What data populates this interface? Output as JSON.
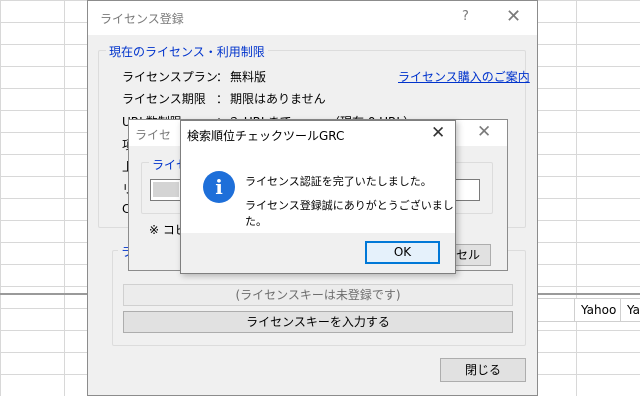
{
  "background": {
    "cells": [
      "Yahoo",
      "Ya"
    ]
  },
  "main_window": {
    "title": "ライセンス登録",
    "help_glyph": "?",
    "close_glyph": "✕",
    "current_group": {
      "legend": "現在のライセンス・利用制限",
      "plan_label": "ライセンスプラン",
      "plan_colon": "：",
      "plan_value": "無料版",
      "period_label": "ライセンス期限",
      "period_colon": "：",
      "period_value": "期限はありません",
      "purchase_link": "ライセンス購入のご案内",
      "partial_rows": [
        "URL数制限",
        "項",
        "上",
        "リ",
        "C"
      ],
      "partial_url_value": "：３ URLまで",
      "partial_url_current": "（現在 0 URL）"
    },
    "key_group": {
      "legend_partial": "ラ",
      "unregistered_button": "(ライセンスキーは未登録です)",
      "enter_key_button": "ライセンスキーを入力する"
    },
    "close_button": "閉じる"
  },
  "license_input_dialog": {
    "title_partial": "ライセ",
    "close_glyph": "✕",
    "group_legend_partial": "ライセ",
    "note_partial": "※ コピ",
    "cancel_partial": "セル"
  },
  "message_box": {
    "title": "検索順位チェックツールGRC",
    "close_glyph": "✕",
    "icon": "information-icon",
    "icon_glyph": "i",
    "line1": "ライセンス認証を完了いたしました。",
    "line2": "ライセンス登録誠にありがとうございました。",
    "ok_button": "OK"
  },
  "colors": {
    "accent": "#0078d7",
    "link": "#0033cc",
    "info_icon": "#1e6fd9"
  }
}
